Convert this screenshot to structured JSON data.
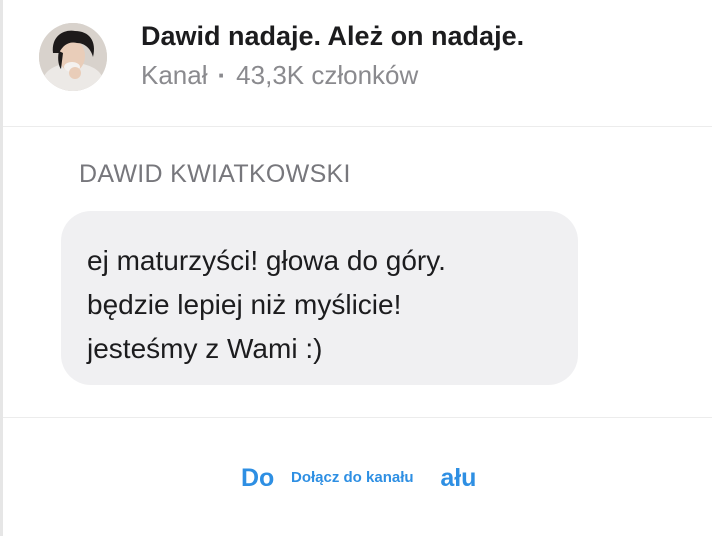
{
  "channel": {
    "title": "Dawid nadaje. Ależ on nadaje.",
    "type_label": "Kanał",
    "separator": "·",
    "members": "43,3K członków"
  },
  "message": {
    "sender": "DAWID KWIATKOWSKI",
    "text": "ej maturzyści! głowa do góry.\nbędzie lepiej niż myślicie!\njesteśmy z Wami :)"
  },
  "footer": {
    "join_label_start": "Do",
    "join_label_end": "ału",
    "join_overlay_label": "Dołącz do kanału",
    "accent_color": "#2e8fe3"
  }
}
